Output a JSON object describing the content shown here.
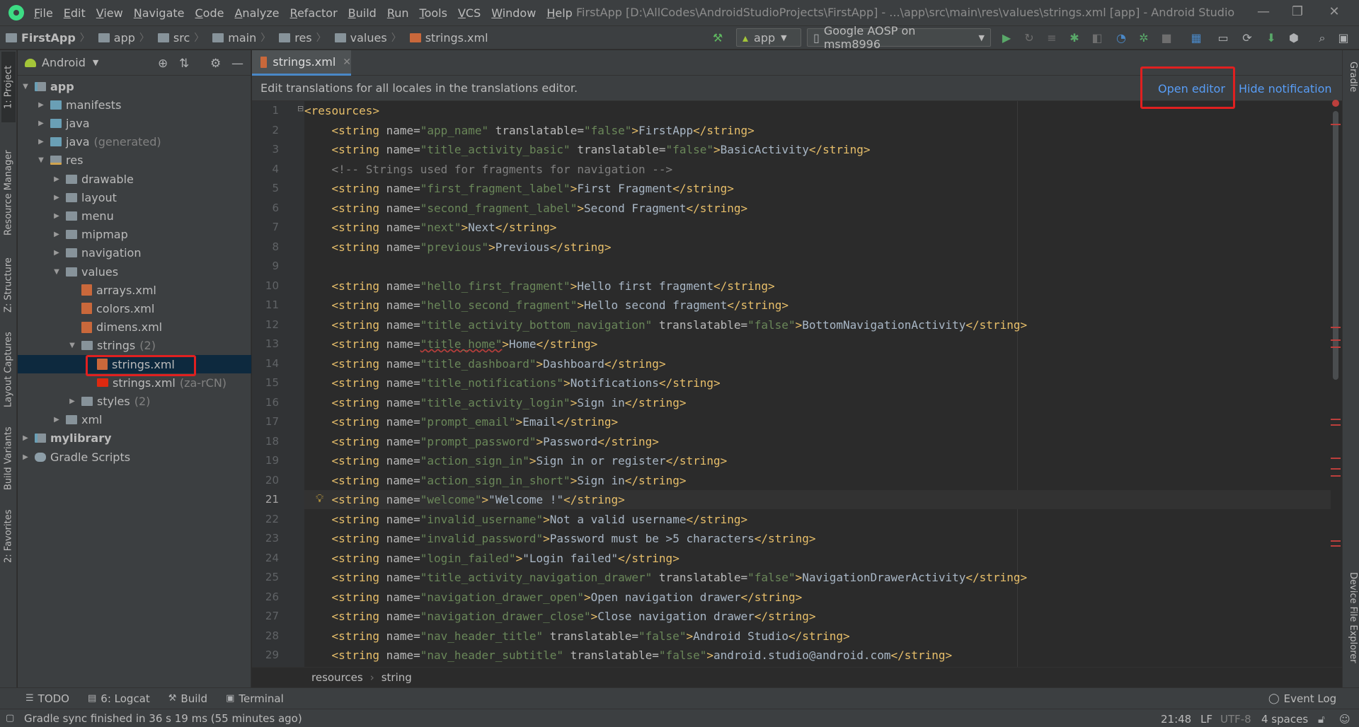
{
  "menu": [
    "File",
    "Edit",
    "View",
    "Navigate",
    "Code",
    "Analyze",
    "Refactor",
    "Build",
    "Run",
    "Tools",
    "VCS",
    "Window",
    "Help"
  ],
  "window_title": "FirstApp [D:\\AllCodes\\AndroidStudioProjects\\FirstApp] - ...\\app\\src\\main\\res\\values\\strings.xml [app] - Android Studio",
  "nav_breadcrumbs": [
    "FirstApp",
    "app",
    "src",
    "main",
    "res",
    "values",
    "strings.xml"
  ],
  "toolbar": {
    "run_config": "app",
    "device": "Google AOSP on msm8996"
  },
  "left_tabs": [
    "1: Project",
    "Resource Manager",
    "Z: Structure",
    "Layout Captures",
    "Build Variants",
    "2: Favorites"
  ],
  "right_tabs": [
    "Gradle",
    "Device File Explorer"
  ],
  "project": {
    "view": "Android",
    "tree": [
      {
        "label": "app",
        "depth": 0,
        "open": true,
        "icon": "module",
        "bold": true
      },
      {
        "label": "manifests",
        "depth": 1,
        "open": false,
        "icon": "folder-blue"
      },
      {
        "label": "java",
        "depth": 1,
        "open": false,
        "icon": "folder-blue"
      },
      {
        "label": "java",
        "suffix": "(generated)",
        "depth": 1,
        "open": false,
        "icon": "folder-blue"
      },
      {
        "label": "res",
        "depth": 1,
        "open": true,
        "icon": "folder-res"
      },
      {
        "label": "drawable",
        "depth": 2,
        "open": false,
        "icon": "folder"
      },
      {
        "label": "layout",
        "depth": 2,
        "open": false,
        "icon": "folder"
      },
      {
        "label": "menu",
        "depth": 2,
        "open": false,
        "icon": "folder"
      },
      {
        "label": "mipmap",
        "depth": 2,
        "open": false,
        "icon": "folder"
      },
      {
        "label": "navigation",
        "depth": 2,
        "open": false,
        "icon": "folder"
      },
      {
        "label": "values",
        "depth": 2,
        "open": true,
        "icon": "folder"
      },
      {
        "label": "arrays.xml",
        "depth": 3,
        "icon": "xml"
      },
      {
        "label": "colors.xml",
        "depth": 3,
        "icon": "xml"
      },
      {
        "label": "dimens.xml",
        "depth": 3,
        "icon": "xml"
      },
      {
        "label": "strings",
        "suffix": "(2)",
        "depth": 3,
        "open": true,
        "icon": "folder"
      },
      {
        "label": "strings.xml",
        "depth": 4,
        "icon": "xml",
        "selected": true
      },
      {
        "label": "strings.xml",
        "suffix": "(za-rCN)",
        "depth": 4,
        "icon": "flag"
      },
      {
        "label": "styles",
        "suffix": "(2)",
        "depth": 3,
        "open": false,
        "icon": "folder"
      },
      {
        "label": "xml",
        "depth": 2,
        "open": false,
        "icon": "folder"
      },
      {
        "label": "mylibrary",
        "depth": 0,
        "open": false,
        "icon": "module",
        "bold": true
      },
      {
        "label": "Gradle Scripts",
        "depth": 0,
        "open": false,
        "icon": "gradle"
      }
    ]
  },
  "editor": {
    "tab_label": "strings.xml",
    "notification": "Edit translations for all locales in the translations editor.",
    "open_editor": "Open editor",
    "hide_notification": "Hide notification",
    "current_line": 21,
    "lines": [
      "<resources>",
      "    <string name=\"app_name\" translatable=\"false\">FirstApp</string>",
      "    <string name=\"title_activity_basic\" translatable=\"false\">BasicActivity</string>",
      "    <!-- Strings used for fragments for navigation -->",
      "    <string name=\"first_fragment_label\">First Fragment</string>",
      "    <string name=\"second_fragment_label\">Second Fragment</string>",
      "    <string name=\"next\">Next</string>",
      "    <string name=\"previous\">Previous</string>",
      "",
      "    <string name=\"hello_first_fragment\">Hello first fragment</string>",
      "    <string name=\"hello_second_fragment\">Hello second fragment</string>",
      "    <string name=\"title_activity_bottom_navigation\" translatable=\"false\">BottomNavigationActivity</string>",
      "    <string name=\"title_home\">Home</string>",
      "    <string name=\"title_dashboard\">Dashboard</string>",
      "    <string name=\"title_notifications\">Notifications</string>",
      "    <string name=\"title_activity_login\">Sign in</string>",
      "    <string name=\"prompt_email\">Email</string>",
      "    <string name=\"prompt_password\">Password</string>",
      "    <string name=\"action_sign_in\">Sign in or register</string>",
      "    <string name=\"action_sign_in_short\">Sign in</string>",
      "    <string name=\"welcome\">\"Welcome !\"</string>",
      "    <string name=\"invalid_username\">Not a valid username</string>",
      "    <string name=\"invalid_password\">Password must be >5 characters</string>",
      "    <string name=\"login_failed\">\"Login failed\"</string>",
      "    <string name=\"title_activity_navigation_drawer\" translatable=\"false\">NavigationDrawerActivity</string>",
      "    <string name=\"navigation_drawer_open\">Open navigation drawer</string>",
      "    <string name=\"navigation_drawer_close\">Close navigation drawer</string>",
      "    <string name=\"nav_header_title\" translatable=\"false\">Android Studio</string>",
      "    <string name=\"nav_header_subtitle\" translatable=\"false\">android.studio@android.com</string>"
    ],
    "breadcrumb": [
      "resources",
      "string"
    ]
  },
  "bottom_tools": [
    {
      "label": "TODO",
      "icon": "list-icon"
    },
    {
      "label": "6: Logcat",
      "icon": "logcat-icon"
    },
    {
      "label": "Build",
      "icon": "hammer-icon"
    },
    {
      "label": "Terminal",
      "icon": "terminal-icon"
    }
  ],
  "event_log": "Event Log",
  "status": {
    "message": "Gradle sync finished in 36 s 19 ms (55 minutes ago)",
    "position": "21:48",
    "line_sep": "LF",
    "encoding": "UTF-8",
    "indent": "4 spaces"
  }
}
